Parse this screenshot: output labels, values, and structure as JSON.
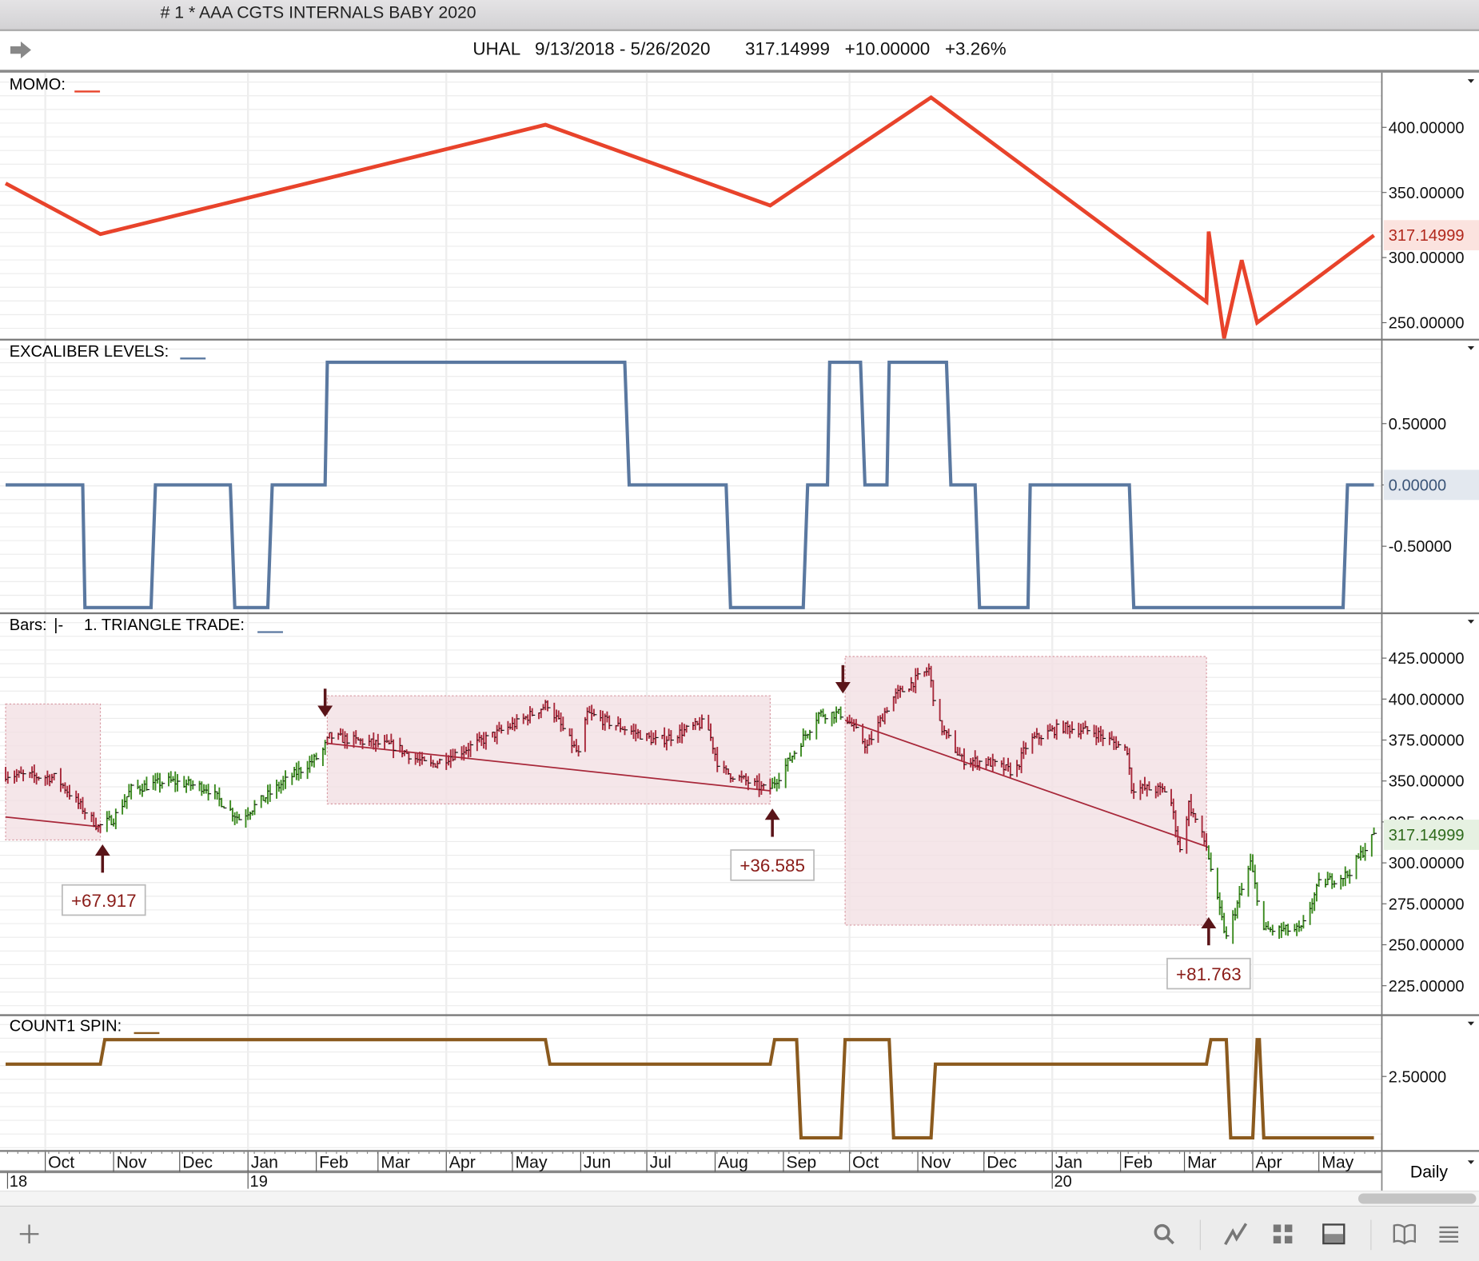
{
  "window": {
    "title": "# 1 * AAA  CGTS INTERNALS BABY 2020"
  },
  "header": {
    "symbol": "UHAL",
    "date_range": "9/13/2018 - 5/26/2020",
    "last": "317.14999",
    "change": "+10.00000",
    "change_pct": "+3.26%"
  },
  "timeframe": "Daily",
  "colors": {
    "momo": "#e8432b",
    "excaliber": "#5a78a0",
    "count1": "#8b5a1e",
    "up_bar": "#3a8a1e",
    "down_bar": "#a8283a",
    "box": "#f3e0e3",
    "trend": "#a8283a",
    "arrow": "#5a1418"
  },
  "chart_data": [
    {
      "type": "line",
      "title": "MOMO:",
      "ylim": [
        235,
        440
      ],
      "yticks": [
        "400.00000",
        "350.00000",
        "300.00000",
        "250.00000"
      ],
      "ytick_values": [
        400,
        350,
        300,
        250
      ],
      "last_label": "317.14999",
      "last_value": 317.15,
      "points": [
        [
          "2018-09-13",
          357
        ],
        [
          "2018-10-26",
          318
        ],
        [
          "2019-05-16",
          402
        ],
        [
          "2019-08-26",
          340
        ],
        [
          "2019-11-07",
          423
        ],
        [
          "2020-03-11",
          266
        ],
        [
          "2020-03-12",
          320
        ],
        [
          "2020-03-19",
          238
        ],
        [
          "2020-03-27",
          298
        ],
        [
          "2020-04-03",
          250
        ],
        [
          "2020-05-26",
          317
        ]
      ]
    },
    {
      "type": "line",
      "title": "EXCALIBER LEVELS:",
      "ylim": [
        -1.05,
        1.05
      ],
      "yticks": [
        "0.50000",
        "0.00000",
        "-0.50000"
      ],
      "ytick_values": [
        0.5,
        0,
        -0.5
      ],
      "last_label": "0.00000",
      "last_value": 0,
      "segments": [
        [
          "2018-09-13",
          "2018-10-18",
          0
        ],
        [
          "2018-10-19",
          "2018-11-18",
          -1
        ],
        [
          "2018-11-20",
          "2018-12-24",
          0
        ],
        [
          "2018-12-26",
          "2019-01-10",
          -1
        ],
        [
          "2019-01-12",
          "2019-02-05",
          0
        ],
        [
          "2019-02-06",
          "2019-06-21",
          1
        ],
        [
          "2019-06-23",
          "2019-08-06",
          0
        ],
        [
          "2019-08-08",
          "2019-09-10",
          -1
        ],
        [
          "2019-09-12",
          "2019-09-21",
          0
        ],
        [
          "2019-09-22",
          "2019-10-06",
          1
        ],
        [
          "2019-10-08",
          "2019-10-18",
          0
        ],
        [
          "2019-10-19",
          "2019-11-14",
          1
        ],
        [
          "2019-11-16",
          "2019-11-27",
          0
        ],
        [
          "2019-11-29",
          "2019-12-21",
          -1
        ],
        [
          "2019-12-22",
          "2020-02-05",
          0
        ],
        [
          "2020-02-07",
          "2020-05-12",
          -1
        ],
        [
          "2020-05-14",
          "2020-05-26",
          0
        ]
      ]
    },
    {
      "type": "ohlc",
      "title": "Bars:",
      "bars_style": "|-",
      "study": "1. TRIANGLE TRADE:",
      "ylim": [
        213,
        432
      ],
      "yticks": [
        "425.00000",
        "400.00000",
        "375.00000",
        "350.00000",
        "325.00000",
        "300.00000",
        "275.00000",
        "250.00000",
        "225.00000"
      ],
      "ytick_values": [
        425,
        400,
        375,
        350,
        325,
        300,
        275,
        250,
        225
      ],
      "last_label": "317.14999",
      "last_value": 317.15,
      "close_path": [
        [
          "2018-09-13",
          354
        ],
        [
          "2018-10-06",
          352
        ],
        [
          "2018-10-25",
          322
        ],
        [
          "2018-11-01",
          327
        ],
        [
          "2018-11-09",
          345
        ],
        [
          "2018-11-26",
          350
        ],
        [
          "2018-12-13",
          346
        ],
        [
          "2018-12-28",
          327
        ],
        [
          "2019-01-17",
          349
        ],
        [
          "2019-02-03",
          366
        ],
        [
          "2019-02-07",
          377
        ],
        [
          "2019-03-09",
          371
        ],
        [
          "2019-03-24",
          359
        ],
        [
          "2019-04-12",
          371
        ],
        [
          "2019-05-04",
          386
        ],
        [
          "2019-05-17",
          397
        ],
        [
          "2019-05-31",
          366
        ],
        [
          "2019-06-04",
          391
        ],
        [
          "2019-07-06",
          374
        ],
        [
          "2019-07-28",
          386
        ],
        [
          "2019-08-03",
          357
        ],
        [
          "2019-08-25",
          344
        ],
        [
          "2019-08-31",
          355
        ],
        [
          "2019-09-17",
          391
        ],
        [
          "2019-09-28",
          391
        ],
        [
          "2019-10-09",
          371
        ],
        [
          "2019-10-20",
          400
        ],
        [
          "2019-11-06",
          418
        ],
        [
          "2019-11-10",
          386
        ],
        [
          "2019-11-21",
          363
        ],
        [
          "2019-12-04",
          361
        ],
        [
          "2019-12-15",
          355
        ],
        [
          "2019-12-21",
          374
        ],
        [
          "2020-01-05",
          383
        ],
        [
          "2020-01-20",
          380
        ],
        [
          "2020-02-04",
          369
        ],
        [
          "2020-02-06",
          346
        ],
        [
          "2020-02-23",
          344
        ],
        [
          "2020-02-28",
          307
        ],
        [
          "2020-03-03",
          336
        ],
        [
          "2020-03-11",
          310
        ],
        [
          "2020-03-16",
          276
        ],
        [
          "2020-03-20",
          254
        ],
        [
          "2020-03-31",
          300
        ],
        [
          "2020-04-06",
          259
        ],
        [
          "2020-04-23",
          259
        ],
        [
          "2020-05-01",
          287
        ],
        [
          "2020-05-14",
          293
        ],
        [
          "2020-05-26",
          317
        ]
      ],
      "trades": [
        {
          "box_start": "2018-09-13",
          "box_end": "2018-10-26",
          "box_high": 397,
          "box_low": 314,
          "trend_start": 328,
          "trend_end": 322,
          "signal": "up",
          "signal_date": "2018-10-27",
          "profit": "+67.917"
        },
        {
          "box_start": "2019-02-06",
          "box_end": "2019-08-26",
          "box_high": 402,
          "box_low": 336,
          "trend_start": 373,
          "trend_end": 344,
          "entry_date": "2019-02-06",
          "signal": "up",
          "signal_date": "2019-08-27",
          "profit": "+36.585"
        },
        {
          "box_start": "2019-09-29",
          "box_end": "2020-03-11",
          "box_high": 426,
          "box_low": 262,
          "trend_start": 387,
          "trend_end": 310,
          "entry_date": "2019-09-29",
          "signal": "up",
          "signal_date": "2020-03-12",
          "profit": "+81.763"
        }
      ]
    },
    {
      "type": "line",
      "title": "COUNT1 SPIN:",
      "ylim": [
        -0.3,
        4.6
      ],
      "yticks": [
        "2.50000"
      ],
      "ytick_values": [
        2.5
      ],
      "segments": [
        [
          "2018-09-13",
          "2018-10-26",
          3
        ],
        [
          "2018-10-28",
          "2019-05-16",
          4
        ],
        [
          "2019-05-18",
          "2019-08-26",
          3
        ],
        [
          "2019-08-28",
          "2019-09-07",
          4
        ],
        [
          "2019-09-09",
          "2019-09-27",
          0
        ],
        [
          "2019-09-29",
          "2019-10-19",
          4
        ],
        [
          "2019-10-21",
          "2019-11-07",
          0
        ],
        [
          "2019-11-09",
          "2020-03-11",
          3
        ],
        [
          "2020-03-13",
          "2020-03-20",
          4
        ],
        [
          "2020-03-22",
          "2020-04-01",
          0
        ],
        [
          "2020-04-03",
          "2020-04-04",
          4
        ],
        [
          "2020-04-06",
          "2020-05-26",
          0
        ]
      ]
    }
  ],
  "time_axis": {
    "months": [
      [
        "2018-10-01",
        "Oct"
      ],
      [
        "2018-11-01",
        "Nov"
      ],
      [
        "2018-12-01",
        "Dec"
      ],
      [
        "2019-01-01",
        "Jan"
      ],
      [
        "2019-02-01",
        "Feb"
      ],
      [
        "2019-03-01",
        "Mar"
      ],
      [
        "2019-04-01",
        "Apr"
      ],
      [
        "2019-05-01",
        "May"
      ],
      [
        "2019-06-01",
        "Jun"
      ],
      [
        "2019-07-01",
        "Jul"
      ],
      [
        "2019-08-01",
        "Aug"
      ],
      [
        "2019-09-01",
        "Sep"
      ],
      [
        "2019-10-01",
        "Oct"
      ],
      [
        "2019-11-01",
        "Nov"
      ],
      [
        "2019-12-01",
        "Dec"
      ],
      [
        "2020-01-01",
        "Jan"
      ],
      [
        "2020-02-01",
        "Feb"
      ],
      [
        "2020-03-01",
        "Mar"
      ],
      [
        "2020-04-01",
        "Apr"
      ],
      [
        "2020-05-01",
        "May"
      ]
    ],
    "years": [
      [
        "2018-09-13",
        "18"
      ],
      [
        "2019-01-01",
        "19"
      ],
      [
        "2020-01-01",
        "20"
      ]
    ]
  }
}
